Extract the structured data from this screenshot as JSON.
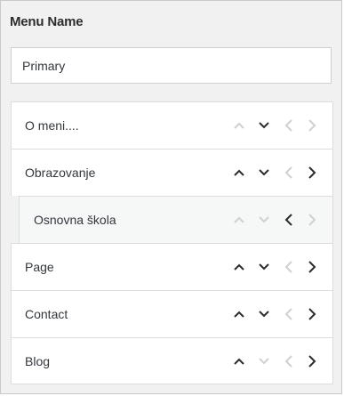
{
  "menu_name_label": "Menu Name",
  "menu_name_value": "Primary",
  "colors": {
    "active_arrow": "#2b2b2b",
    "disabled_arrow": "#d0d0d0"
  },
  "items": [
    {
      "label": "O meni....",
      "child": false,
      "up": false,
      "down": true,
      "left": false,
      "right": false
    },
    {
      "label": "Obrazovanje",
      "child": false,
      "up": true,
      "down": true,
      "left": false,
      "right": true
    },
    {
      "label": "Osnovna škola",
      "child": true,
      "up": false,
      "down": false,
      "left": true,
      "right": false
    },
    {
      "label": "Page",
      "child": false,
      "up": true,
      "down": true,
      "left": false,
      "right": true
    },
    {
      "label": "Contact",
      "child": false,
      "up": true,
      "down": true,
      "left": false,
      "right": true
    },
    {
      "label": "Blog",
      "child": false,
      "up": true,
      "down": false,
      "left": false,
      "right": true
    }
  ]
}
